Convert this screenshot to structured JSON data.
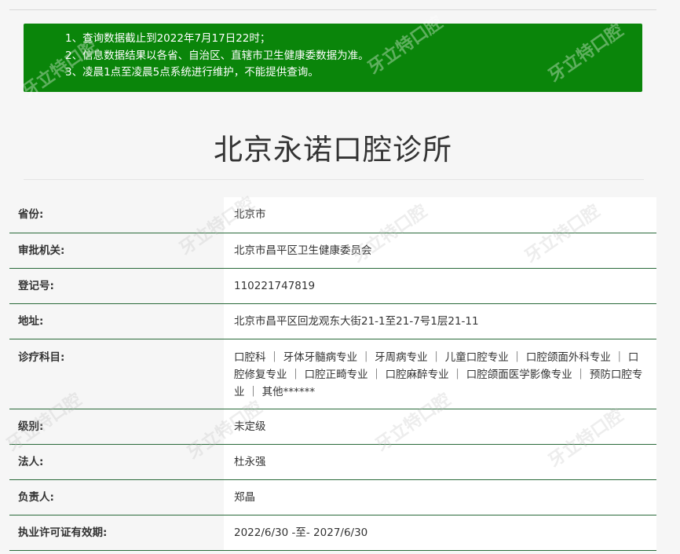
{
  "notice": {
    "lines": [
      "1、查询数据截止到2022年7月17日22时；",
      "2、信息数据结果以各省、自治区、直辖市卫生健康委数据为准。",
      "3、凌晨1点至凌晨5点系统进行维护，不能提供查询。"
    ]
  },
  "title": "北京永诺口腔诊所",
  "rows": [
    {
      "label": "省份:",
      "value": "北京市"
    },
    {
      "label": "审批机关:",
      "value": "北京市昌平区卫生健康委员会"
    },
    {
      "label": "登记号:",
      "value": "110221747819"
    },
    {
      "label": "地址:",
      "value": "北京市昌平区回龙观东大街21-1至21-7号1层21-11"
    },
    {
      "label": "诊疗科目:",
      "value": "口腔科 ｜ 牙体牙髓病专业 ｜ 牙周病专业 ｜ 儿童口腔专业 ｜ 口腔颌面外科专业 ｜ 口腔修复专业 ｜ 口腔正畸专业 ｜ 口腔麻醉专业 ｜ 口腔颌面医学影像专业 ｜ 预防口腔专业 ｜ 其他******"
    },
    {
      "label": "级别:",
      "value": "未定级"
    },
    {
      "label": "法人:",
      "value": "杜永强"
    },
    {
      "label": "负责人:",
      "value": "郑晶"
    },
    {
      "label": "执业许可证有效期:",
      "value": "2022/6/30 -至- 2027/6/30"
    }
  ],
  "watermark": "牙立特口腔",
  "colors": {
    "notice_bg": "#0a850a",
    "row_border": "#2a6a3a",
    "page_bg": "#f6f6f6"
  }
}
